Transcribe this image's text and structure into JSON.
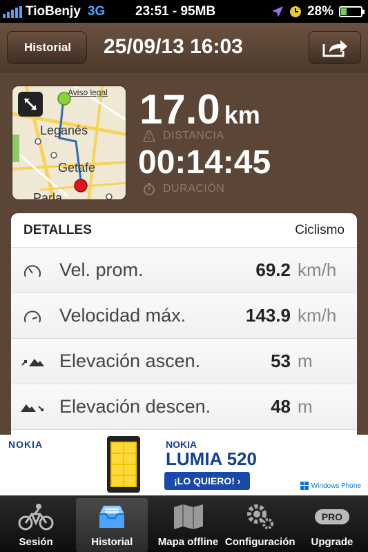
{
  "status": {
    "carrier": "TioBenjy",
    "network": "3G",
    "time_mem": "23:51 - 95MB",
    "battery": "28%",
    "battery_level": 0.28
  },
  "nav": {
    "back_label": "Historial",
    "title": "25/09/13 16:03"
  },
  "map": {
    "legal": "Aviso legal",
    "places": [
      "Leganés",
      "Getafe",
      "Parla"
    ]
  },
  "summary": {
    "distance_value": "17.0",
    "distance_unit": "km",
    "distance_label": "DISTANCIA",
    "duration_value": "00:14:45",
    "duration_label": "DURACIÓN"
  },
  "details": {
    "title": "DETALLES",
    "activity": "Ciclismo",
    "rows": [
      {
        "label": "Vel. prom.",
        "value": "69.2",
        "unit": "km/h",
        "icon": "speedometer-icon"
      },
      {
        "label": "Velocidad máx.",
        "value": "143.9",
        "unit": "km/h",
        "icon": "speedometer-max-icon"
      },
      {
        "label": "Elevación ascen.",
        "value": "53",
        "unit": "m",
        "icon": "elevation-up-icon"
      },
      {
        "label": "Elevación descen.",
        "value": "48",
        "unit": "m",
        "icon": "elevation-down-icon"
      }
    ]
  },
  "ad": {
    "brand": "NOKIA",
    "brand2": "NOKIA",
    "model": "LUMIA 520",
    "cta": "¡LO QUIERO! ›",
    "platform": "Windows Phone"
  },
  "tabs": [
    {
      "label": "Sesión",
      "icon": "bicycle-icon"
    },
    {
      "label": "Historial",
      "icon": "inbox-icon"
    },
    {
      "label": "Mapa offline",
      "icon": "map-icon"
    },
    {
      "label": "Configuración",
      "icon": "gear-icon"
    },
    {
      "label": "Upgrade",
      "icon": "pro-icon",
      "badge": "PRO"
    }
  ],
  "colors": {
    "background": "#5a4536",
    "accent_blue": "#4aa3ff",
    "battery_green": "#6bd34a",
    "route_start": "#8cd23c",
    "route_end": "#e0141e"
  }
}
